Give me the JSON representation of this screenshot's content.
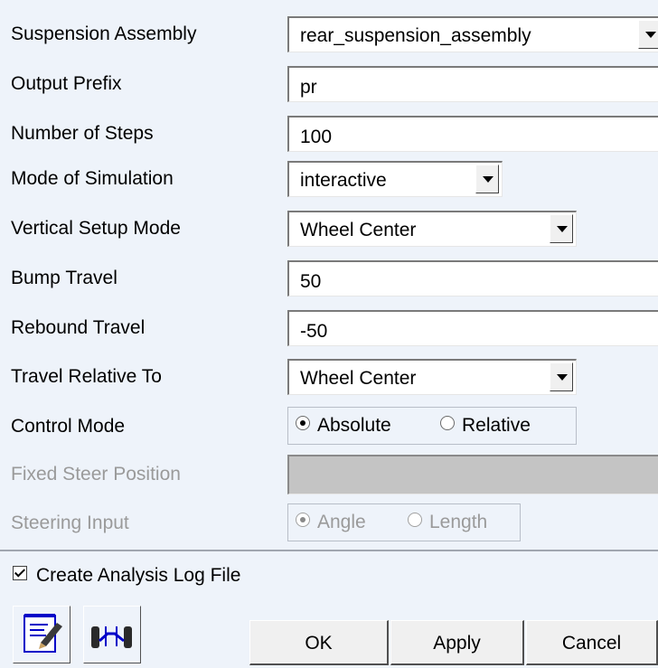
{
  "form": {
    "suspension_assembly": {
      "label": "Suspension Assembly",
      "value": "rear_suspension_assembly"
    },
    "output_prefix": {
      "label": "Output Prefix",
      "value": "pr"
    },
    "number_of_steps": {
      "label": "Number of Steps",
      "value": "100"
    },
    "mode_of_simulation": {
      "label": "Mode of Simulation",
      "value": "interactive"
    },
    "vertical_setup_mode": {
      "label": "Vertical Setup Mode",
      "value": "Wheel Center"
    },
    "bump_travel": {
      "label": "Bump Travel",
      "value": "50"
    },
    "rebound_travel": {
      "label": "Rebound Travel",
      "value": "-50"
    },
    "travel_relative_to": {
      "label": "Travel Relative To",
      "value": "Wheel Center"
    },
    "control_mode": {
      "label": "Control Mode",
      "options": [
        "Absolute",
        "Relative"
      ],
      "selected": "Absolute"
    },
    "fixed_steer_position": {
      "label": "Fixed Steer Position",
      "value": "",
      "disabled": true
    },
    "steering_input": {
      "label": "Steering Input",
      "options": [
        "Angle",
        "Length"
      ],
      "selected": "Angle",
      "disabled": true
    }
  },
  "log_file": {
    "label": "Create Analysis Log File",
    "checked": true
  },
  "icons": {
    "left": "notepad-pen-icon",
    "right": "suspension-icon"
  },
  "buttons": {
    "ok": "OK",
    "apply": "Apply",
    "cancel": "Cancel"
  }
}
